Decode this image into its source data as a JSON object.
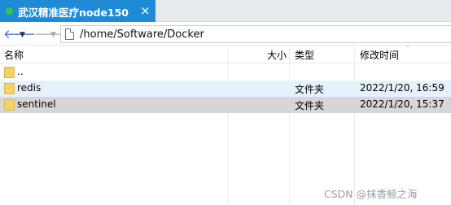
{
  "tab": {
    "title": "武汉精准医疗node150",
    "close_glyph": "×",
    "status_color": "#2ec843",
    "accent": "#1f8bd6"
  },
  "nav": {
    "back_glyph": "🡐",
    "forward_glyph": "🡒",
    "dropdown_glyph": "▼",
    "path": "/home/Software/Docker"
  },
  "columns": {
    "name": "名称",
    "size": "大小",
    "type": "类型",
    "modified": "修改时间",
    "sort_indicator": "ˇ"
  },
  "rows": [
    {
      "name": "..",
      "type": "",
      "modified": ""
    },
    {
      "name": "redis",
      "type": "文件夹",
      "modified": "2022/1/20, 16:59"
    },
    {
      "name": "sentinel",
      "type": "文件夹",
      "modified": "2022/1/20, 15:37"
    }
  ],
  "watermark": "CSDN @抹香鲸之海"
}
